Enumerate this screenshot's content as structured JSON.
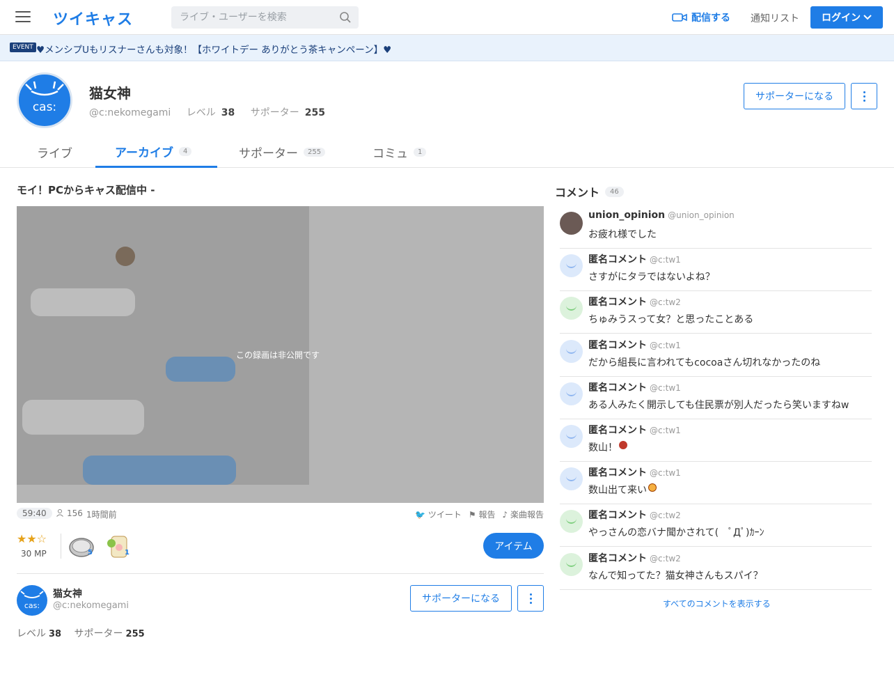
{
  "header": {
    "logo": "ツイキャス",
    "search_placeholder": "ライブ・ユーザーを検索",
    "broadcast_label": "配信する",
    "notice_list_label": "通知リスト",
    "login_label": "ログイン"
  },
  "event": {
    "badge": "EVENT",
    "text": "♥︎メンシプUもリスナーさんも︎対象！【ホワイトデー ありがとう茶キャンペーン】︎♥"
  },
  "profile": {
    "avatar_text": "cas:",
    "name": "猫女神",
    "id": "@c:nekomegami",
    "level_label": "レベル",
    "level": "38",
    "supporter_label": "サポーター",
    "supporters": "255",
    "become_supporter": "サポーターになる"
  },
  "tabs": [
    {
      "label": "ライブ",
      "count": ""
    },
    {
      "label": "アーカイブ",
      "count": "4"
    },
    {
      "label": "サポーター",
      "count": "255"
    },
    {
      "label": "コミュ",
      "count": "1"
    }
  ],
  "video": {
    "title": "モイ！PCからキャス配信中 -",
    "private_text": "この録画は非公開です",
    "duration": "59:40",
    "viewers": "156",
    "ago": "1時間前",
    "tweet": "ツイート",
    "report": "報告",
    "music_report": "楽曲報告",
    "mp": "30 MP",
    "items": [
      {
        "count": "5"
      },
      {
        "count": "1"
      }
    ],
    "item_button": "アイテム"
  },
  "owner": {
    "avatar_text": "cas:",
    "name": "猫女神",
    "id": "@c:nekomegami",
    "level_label": "レベル",
    "level": "38",
    "supporter_label": "サポーター",
    "supporters": "255",
    "become_supporter": "サポーターになる"
  },
  "comments": {
    "title": "コメント",
    "count": "46",
    "items": [
      {
        "name": "union_opinion",
        "id": "@union_opinion",
        "text": "お疲れ様でした"
      },
      {
        "name": "匿名コメント",
        "id": "@c:tw1",
        "text": "さすがにタラではないよね？"
      },
      {
        "name": "匿名コメント",
        "id": "@c:tw2",
        "text": "ちゅみうスって女？と思ったことある"
      },
      {
        "name": "匿名コメント",
        "id": "@c:tw1",
        "text": "だから組長に言われてもcocoaさん切れなかったのね"
      },
      {
        "name": "匿名コメント",
        "id": "@c:tw1",
        "text": "ある人みたく開示しても住民票が別人だったら笑いますねw"
      },
      {
        "name": "匿名コメント",
        "id": "@c:tw1",
        "text": "数山！"
      },
      {
        "name": "匿名コメント",
        "id": "@c:tw1",
        "text": "数山出て来い"
      },
      {
        "name": "匿名コメント",
        "id": "@c:tw2",
        "text": "やっさんの恋バナ聞かされて(　ﾟДﾟ)ｶｰﾝ"
      },
      {
        "name": "匿名コメント",
        "id": "@c:tw2",
        "text": "なんで知ってた？猫女神さんもスパイ？"
      }
    ],
    "show_all": "すべてのコメントを表示する"
  }
}
